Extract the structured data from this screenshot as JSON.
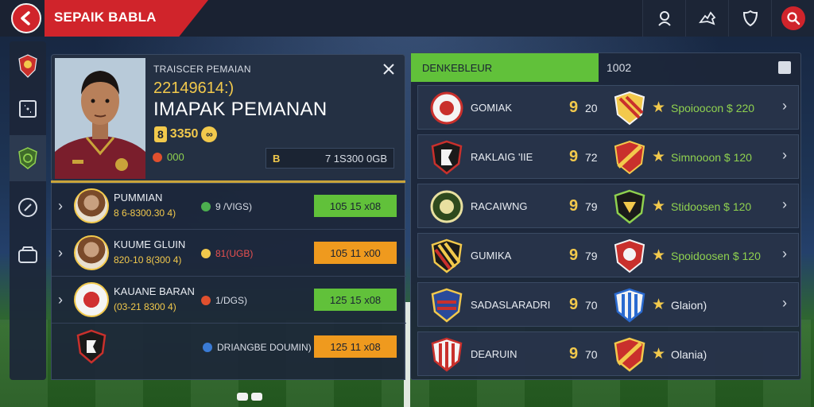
{
  "header": {
    "title": "SEPAIK BABLA",
    "icons": [
      "back-arrow-icon",
      "user-icon",
      "bird-icon",
      "shield-icon",
      "search-icon"
    ]
  },
  "sidebar": {
    "items": [
      {
        "icon": "club-crest-icon"
      },
      {
        "icon": "pitch-icon"
      },
      {
        "icon": "football-icon",
        "active": true
      },
      {
        "icon": "compass-icon"
      },
      {
        "icon": "wallet-icon"
      }
    ]
  },
  "player_card": {
    "subtitle": "TRAISCER PEMAIAN",
    "number_line": "22149614:)",
    "name": "IMAPAK PEMANAN",
    "badge_num": "8",
    "badge_value": "3350",
    "meta": "000",
    "stat_icon": "B",
    "stat_value": "7 1S300 0GB"
  },
  "left_list": [
    {
      "name": "PUMMIAN",
      "sub": "8 6-8300.30 4)",
      "mid": "9 /VIGS)",
      "price": "105 15 x08",
      "color": "green"
    },
    {
      "name": "KUUME GLUIN",
      "sub": "820-10 8(300 4)",
      "mid": "81(UGB)",
      "price": "105 11 x00",
      "color": "orange"
    },
    {
      "name": "KAUANE BARAN",
      "sub": "(03-21 8300 4)",
      "mid": "1/DGS)",
      "price": "125 15 x08",
      "color": "green"
    },
    {
      "name": "",
      "sub": "",
      "mid": "DRIANGBE DOUMIN)",
      "price": "125 11 x08",
      "color": "orange"
    }
  ],
  "right_panel": {
    "active_tab": "DENKEBLEUR",
    "tab2": "1002",
    "rows": [
      {
        "name": "GOMIAK",
        "num": "9",
        "val": "20",
        "side": "Spoioocon $ 220"
      },
      {
        "name": "RAKLAIG 'IIE",
        "num": "9",
        "val": "72",
        "side": "Simnooon $ 120"
      },
      {
        "name": "RACAIWNG",
        "num": "9",
        "val": "79",
        "side": "Stidoosen $ 120"
      },
      {
        "name": "GUMIKA",
        "num": "9",
        "val": "79",
        "side": "Spoidoosen $ 120"
      },
      {
        "name": "SADASLARADRI",
        "num": "9",
        "val": "70",
        "side": "Glaion)"
      },
      {
        "name": "DEARUIN",
        "num": "9",
        "val": "70",
        "side": "Olania)"
      }
    ]
  },
  "colors": {
    "accent_red": "#d0242b",
    "accent_green": "#61c13a",
    "accent_orange": "#ef9a1e",
    "accent_gold": "#f2c94c"
  }
}
